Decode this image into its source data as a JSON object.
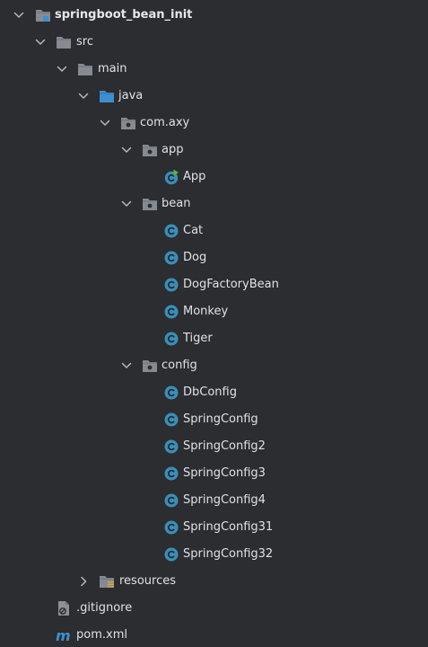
{
  "project": {
    "name": "springboot_bean_init",
    "src": "src",
    "main": "main",
    "java": "java",
    "package": "com.axy",
    "app_pkg": {
      "name": "app",
      "classes": [
        "App"
      ]
    },
    "bean_pkg": {
      "name": "bean",
      "classes": [
        "Cat",
        "Dog",
        "DogFactoryBean",
        "Monkey",
        "Tiger"
      ]
    },
    "config_pkg": {
      "name": "config",
      "classes": [
        "DbConfig",
        "SpringConfig",
        "SpringConfig2",
        "SpringConfig3",
        "SpringConfig4",
        "SpringConfig31",
        "SpringConfig32"
      ]
    },
    "resources": "resources",
    "gitignore": ".gitignore",
    "pom": "pom.xml"
  },
  "icons": {
    "chevron_expanded": "chevron-down-icon",
    "chevron_collapsed": "chevron-right-icon",
    "folder": "folder-icon",
    "source_folder": "source-root-folder-icon",
    "package": "package-icon",
    "class": "class-icon",
    "main_class": "runnable-class-icon",
    "resources": "resources-folder-icon",
    "gitignore": "gitignore-file-icon",
    "maven": "maven-icon"
  },
  "colors": {
    "background": "#2b2d30",
    "text": "#dfe1e5",
    "folder": "#868a91",
    "source_folder": "#3d8fcf",
    "class_circle": "#3a8fb7",
    "run_arrow": "#5fb832",
    "maven_m": "#3d8fcf"
  }
}
